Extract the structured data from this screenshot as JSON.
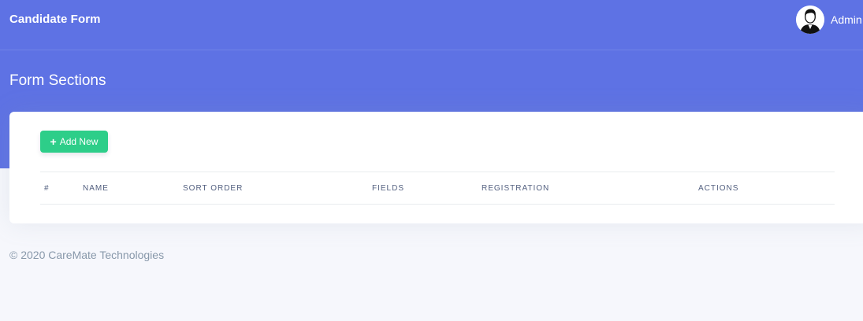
{
  "app": {
    "title": "Candidate Form"
  },
  "user": {
    "name": "Admin",
    "avatar_icon": "user-avatar-icon"
  },
  "page": {
    "title": "Form Sections"
  },
  "toolbar": {
    "add_label": "Add New",
    "add_icon": "plus-icon"
  },
  "table": {
    "columns": [
      "#",
      "NAME",
      "SORT ORDER",
      "FIELDS",
      "REGISTRATION",
      "ACTIONS"
    ],
    "rows": []
  },
  "footer": {
    "text": "© 2020 CareMate Technologies"
  },
  "colors": {
    "primary": "#5e72e4",
    "success": "#2dce89",
    "background": "#f6f7fc"
  }
}
